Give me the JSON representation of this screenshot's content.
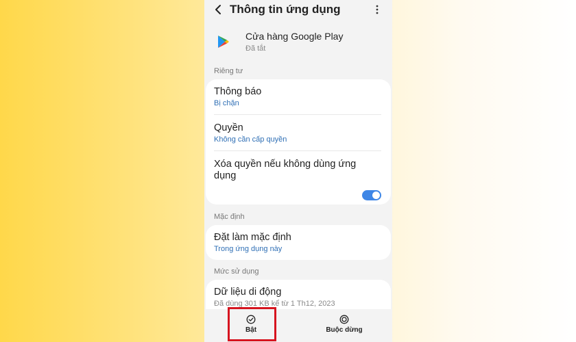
{
  "header": {
    "title": "Thông tin ứng dụng",
    "back_icon": "back-arrow-icon",
    "more_icon": "more-vertical-icon"
  },
  "app": {
    "name": "Cửa hàng Google Play",
    "status": "Đã tắt",
    "icon": "google-play-icon"
  },
  "privacy": {
    "section_label": "Riêng tư",
    "notifications": {
      "title": "Thông báo",
      "subtitle": "Bị chặn"
    },
    "permissions": {
      "title": "Quyền",
      "subtitle": "Không cần cấp quyền"
    },
    "remove_permissions": {
      "title": "Xóa quyền nếu không dùng ứng dụng",
      "toggle_on": true
    }
  },
  "defaults": {
    "section_label": "Mặc định",
    "set_default": {
      "title": "Đặt làm mặc định",
      "subtitle": "Trong ứng dụng này"
    }
  },
  "usage": {
    "section_label": "Mức sử dụng",
    "mobile_data": {
      "title": "Dữ liệu di động",
      "subtitle": "Đã dùng 301 KB kể từ 1 Th12, 2023"
    }
  },
  "bottom_bar": {
    "enable": {
      "label": "Bật",
      "icon": "check-circle-icon"
    },
    "force_stop": {
      "label": "Buộc dừng",
      "icon": "stop-circle-icon"
    }
  },
  "colors": {
    "accent": "#3e86e6",
    "link": "#2f6fb5",
    "highlight": "#d6141f"
  }
}
